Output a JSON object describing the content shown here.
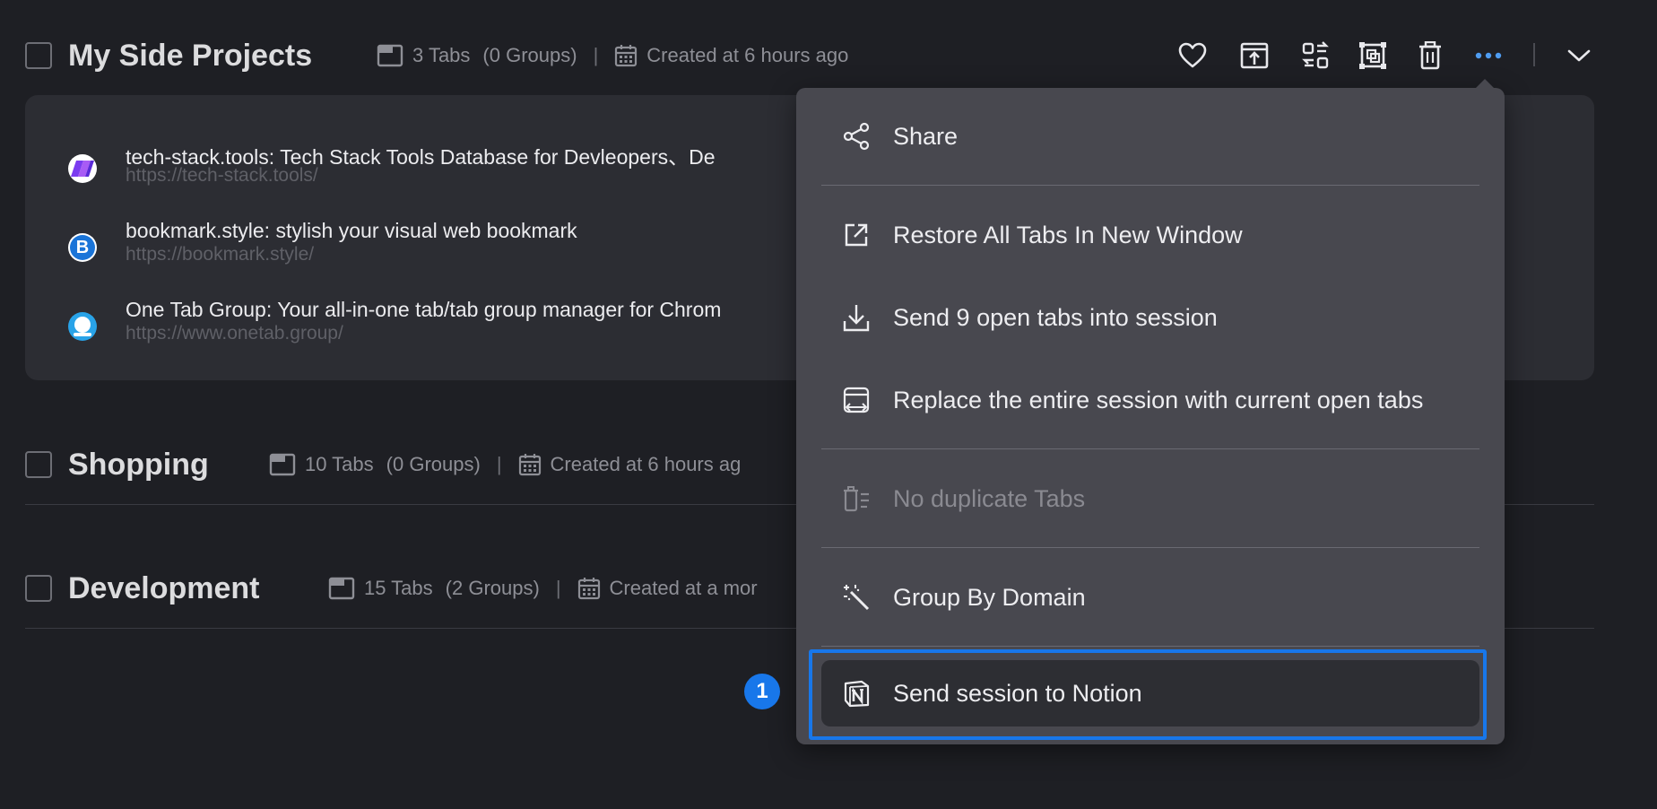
{
  "sessions": [
    {
      "title": "My Side Projects",
      "tabs": "3 Tabs",
      "groups": "(0 Groups)",
      "created": "Created at 6 hours ago"
    },
    {
      "title": "Shopping",
      "tabs": "10 Tabs",
      "groups": "(0 Groups)",
      "created": "Created at 6 hours ag"
    },
    {
      "title": "Development",
      "tabs": "15 Tabs",
      "groups": "(2 Groups)",
      "created": "Created at a mor"
    }
  ],
  "separator": "|",
  "tab_items": [
    {
      "title": "tech-stack.tools: Tech Stack Tools Database for Devleopers、De",
      "url": "https://tech-stack.tools/",
      "favicon_letter": ""
    },
    {
      "title": "bookmark.style: stylish your visual web bookmark",
      "url": "https://bookmark.style/",
      "favicon_letter": "B"
    },
    {
      "title": "One Tab Group: Your all-in-one tab/tab group manager for Chrom",
      "url": "https://www.onetab.group/",
      "favicon_letter": ""
    }
  ],
  "toolbar": {
    "icons": [
      "heart-icon",
      "restore-window-icon",
      "swap-icon",
      "group-frame-icon",
      "trash-icon",
      "more-dots-icon",
      "chevron-down-icon"
    ]
  },
  "menu": {
    "share": "Share",
    "restore_all": "Restore All Tabs In New Window",
    "send_open_tabs": "Send 9 open tabs into session",
    "replace_session": "Replace the entire session with current open tabs",
    "no_duplicate": "No duplicate Tabs",
    "group_by_domain": "Group By Domain",
    "send_to_notion": "Send session to Notion"
  },
  "step_badge": "1",
  "colors": {
    "background": "#1e1f24",
    "card": "#2c2d33",
    "menu": "#48484f",
    "accent": "#1877ea",
    "more_dots": "#4f9cf0"
  }
}
